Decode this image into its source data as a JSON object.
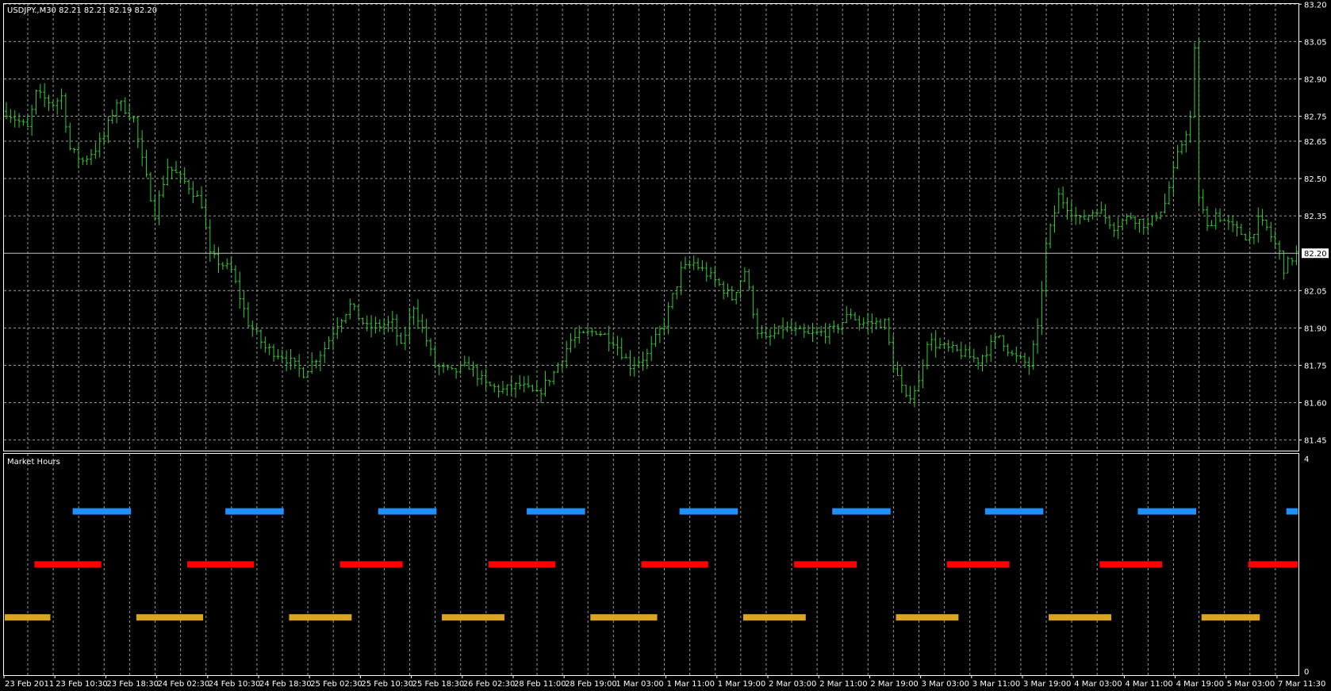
{
  "main_pane": {
    "symbol_label": "USDJPY.,M30  82.21 82.21 82.19 82.20",
    "current_price": "82.20",
    "price_labels": [
      "83.20",
      "83.05",
      "82.90",
      "82.75",
      "82.65",
      "82.50",
      "82.35",
      "82.05",
      "81.90",
      "81.75",
      "81.60",
      "81.45"
    ]
  },
  "indicator_pane": {
    "title": "Market Hours",
    "scale_max": "4",
    "scale_min": "0"
  },
  "time_labels": [
    "23 Feb 2011",
    "23 Feb 10:30",
    "23 Feb 18:30",
    "24 Feb 02:30",
    "24 Feb 10:30",
    "24 Feb 18:30",
    "25 Feb 02:30",
    "25 Feb 10:30",
    "25 Feb 18:30",
    "26 Feb 02:30",
    "28 Feb 11:00",
    "28 Feb 19:00",
    "1 Mar 03:00",
    "1 Mar 11:00",
    "1 Mar 19:00",
    "2 Mar 03:00",
    "2 Mar 11:00",
    "2 Mar 19:00",
    "3 Mar 03:00",
    "3 Mar 11:00",
    "3 Mar 19:00",
    "4 Mar 03:00",
    "4 Mar 11:00",
    "4 Mar 19:00",
    "5 Mar 03:00",
    "7 Mar 11:30"
  ],
  "colors": {
    "background": "#000000",
    "grid": "#c0c0c0",
    "bars": "#33cc33",
    "blue": "#1e90ff",
    "red": "#ff0000",
    "orange": "#daa520"
  },
  "chart_data": {
    "type": "ohlc-bar",
    "title": "USDJPY., M30",
    "ylim": [
      81.45,
      83.2
    ],
    "bar_count": 305,
    "price_path": [
      [
        0,
        82.77
      ],
      [
        5,
        82.7
      ],
      [
        7,
        82.84
      ],
      [
        11,
        82.8
      ],
      [
        13,
        82.83
      ],
      [
        15,
        82.62
      ],
      [
        16,
        82.6
      ],
      [
        18,
        82.57
      ],
      [
        21,
        82.62
      ],
      [
        23,
        82.67
      ],
      [
        26,
        82.81
      ],
      [
        28,
        82.78
      ],
      [
        30,
        82.74
      ],
      [
        32,
        82.57
      ],
      [
        35,
        82.36
      ],
      [
        38,
        82.55
      ],
      [
        43,
        82.47
      ],
      [
        46,
        82.4
      ],
      [
        48,
        82.19
      ],
      [
        53,
        82.13
      ],
      [
        57,
        81.92
      ],
      [
        61,
        81.82
      ],
      [
        65,
        81.79
      ],
      [
        70,
        81.72
      ],
      [
        75,
        81.82
      ],
      [
        78,
        81.92
      ],
      [
        81,
        81.99
      ],
      [
        85,
        81.9
      ],
      [
        91,
        81.92
      ],
      [
        93,
        81.82
      ],
      [
        96,
        81.99
      ],
      [
        99,
        81.85
      ],
      [
        101,
        81.75
      ],
      [
        105,
        81.72
      ],
      [
        109,
        81.75
      ],
      [
        113,
        81.67
      ],
      [
        117,
        81.65
      ],
      [
        121,
        81.67
      ],
      [
        125,
        81.63
      ],
      [
        129,
        81.72
      ],
      [
        133,
        81.85
      ],
      [
        139,
        81.89
      ],
      [
        143,
        81.85
      ],
      [
        147,
        81.75
      ],
      [
        151,
        81.79
      ],
      [
        155,
        81.92
      ],
      [
        159,
        82.13
      ],
      [
        162,
        82.16
      ],
      [
        167,
        82.09
      ],
      [
        171,
        82.02
      ],
      [
        174,
        82.13
      ],
      [
        177,
        81.89
      ],
      [
        179,
        81.85
      ],
      [
        183,
        81.9
      ],
      [
        189,
        81.87
      ],
      [
        195,
        81.89
      ],
      [
        199,
        81.96
      ],
      [
        201,
        81.92
      ],
      [
        207,
        81.92
      ],
      [
        209,
        81.75
      ],
      [
        212,
        81.61
      ],
      [
        215,
        81.68
      ],
      [
        217,
        81.85
      ],
      [
        221,
        81.82
      ],
      [
        225,
        81.8
      ],
      [
        229,
        81.77
      ],
      [
        234,
        81.87
      ],
      [
        237,
        81.79
      ],
      [
        241,
        81.75
      ],
      [
        243,
        81.89
      ],
      [
        245,
        82.23
      ],
      [
        248,
        82.43
      ],
      [
        253,
        82.33
      ],
      [
        257,
        82.38
      ],
      [
        261,
        82.31
      ],
      [
        265,
        82.35
      ],
      [
        269,
        82.31
      ],
      [
        273,
        82.4
      ],
      [
        276,
        82.59
      ],
      [
        279,
        82.74
      ],
      [
        280,
        83.01
      ],
      [
        281,
        82.43
      ],
      [
        283,
        82.3
      ],
      [
        285,
        82.36
      ],
      [
        289,
        82.3
      ],
      [
        293,
        82.26
      ],
      [
        295,
        82.33
      ],
      [
        297,
        82.3
      ],
      [
        300,
        82.2
      ],
      [
        301,
        82.14
      ],
      [
        304,
        82.2
      ]
    ],
    "market_hours": [
      {
        "session": "blue",
        "level": 3,
        "color": "#1e90ff",
        "ranges": [
          [
            16,
            29
          ],
          [
            52,
            65
          ],
          [
            88,
            101
          ],
          [
            123,
            136
          ],
          [
            159,
            172
          ],
          [
            195,
            208
          ],
          [
            231,
            244
          ],
          [
            267,
            280
          ],
          [
            302,
            304
          ]
        ]
      },
      {
        "session": "red",
        "level": 2,
        "color": "#ff0000",
        "ranges": [
          [
            7,
            22
          ],
          [
            43,
            58
          ],
          [
            79,
            93
          ],
          [
            114,
            129
          ],
          [
            150,
            165
          ],
          [
            186,
            200
          ],
          [
            222,
            236
          ],
          [
            258,
            272
          ],
          [
            293,
            304
          ]
        ]
      },
      {
        "session": "orange",
        "level": 1,
        "color": "#daa520",
        "ranges": [
          [
            0,
            10
          ],
          [
            31,
            46
          ],
          [
            67,
            81
          ],
          [
            103,
            117
          ],
          [
            138,
            153
          ],
          [
            174,
            188
          ],
          [
            210,
            224
          ],
          [
            246,
            260
          ],
          [
            282,
            295
          ]
        ]
      }
    ]
  }
}
